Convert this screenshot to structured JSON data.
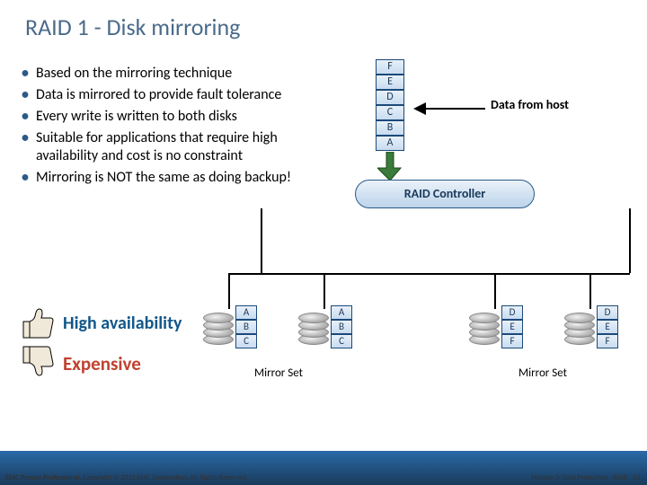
{
  "title": "RAID 1 - Disk mirroring",
  "bullets": [
    "Based on the mirroring technique",
    "Data is mirrored to provide fault tolerance",
    "Every write is written to both disks",
    "Suitable for applications that require high availability and cost is no constraint",
    "Mirroring is NOT the same as doing backup!"
  ],
  "labels": {
    "high_availability": "High availability",
    "expensive": "Expensive",
    "data_from_host": "Data from host",
    "raid_controller": "RAID Controller",
    "mirror_set": "Mirror Set"
  },
  "data_blocks_in": [
    "F",
    "E",
    "D",
    "C",
    "B",
    "A"
  ],
  "disk_stacks": {
    "set1_a": [
      "A",
      "B",
      "C"
    ],
    "set1_b": [
      "A",
      "B",
      "C"
    ],
    "set2_a": [
      "D",
      "E",
      "F"
    ],
    "set2_b": [
      "D",
      "E",
      "F"
    ]
  },
  "footer": {
    "left_bold": "EMC Proven Professional.",
    "left_rest": " Copyright © 2012 EMC Corporation. All Rights Reserved.",
    "right": "Module 3: Data Protection - RAID",
    "page": "23"
  }
}
